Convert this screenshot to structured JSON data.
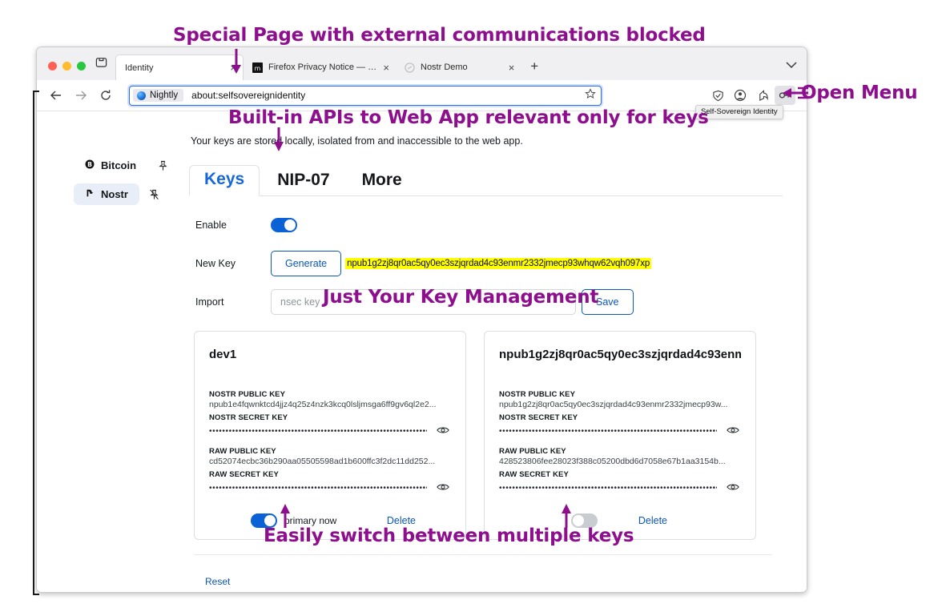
{
  "annotations": [
    {
      "id": "top",
      "text": "Special Page with external communications blocked"
    },
    {
      "id": "apis",
      "text": "Built-in APIs to Web App relevant only for keys"
    },
    {
      "id": "menu",
      "text": "Open Menu"
    },
    {
      "id": "keymgmt",
      "text": "Just Your Key Management"
    },
    {
      "id": "switch",
      "text": "Easily switch between multiple keys"
    }
  ],
  "annotation_color": "#8e0f8e",
  "browser": {
    "tabs": [
      {
        "label": "Identity",
        "favicon": "none",
        "active": true,
        "close": "×"
      },
      {
        "label": "Firefox Privacy Notice — Mozilla",
        "favicon": "mozilla-icon",
        "active": false,
        "close": "×"
      },
      {
        "label": "Nostr Demo",
        "favicon": "nostr-icon",
        "active": false,
        "close": "×"
      }
    ],
    "new_tab_label": "+",
    "window_controls": [
      "close",
      "minimize",
      "maximize"
    ],
    "nav": {
      "back": "←",
      "forward": "→",
      "reload": "⟳"
    },
    "urlbar": {
      "identity_chip": "Nightly",
      "url": "about:selfsovereignidentity",
      "bookmark_icon": "star-icon"
    },
    "toolbar_icons": [
      {
        "name": "shield-icon",
        "highlight": false
      },
      {
        "name": "account-icon",
        "highlight": false
      },
      {
        "name": "share-icon",
        "highlight": false
      },
      {
        "name": "key-icon",
        "highlight": true
      }
    ],
    "tooltip": "Self-Sovereign Identity"
  },
  "sidebar": {
    "items": [
      {
        "label": "Bitcoin",
        "icon": "bitcoin-icon",
        "pin": "pin-icon",
        "active": false
      },
      {
        "label": "Nostr",
        "icon": "nostr-icon",
        "pin": "unpin-icon",
        "active": true
      }
    ]
  },
  "main": {
    "subtitle": "Your keys are stored locally, isolated from and inaccessible to the web app.",
    "tabs": [
      {
        "label": "Keys",
        "active": true
      },
      {
        "label": "NIP-07",
        "active": false
      },
      {
        "label": "More",
        "active": false
      }
    ],
    "form": {
      "enable_label": "Enable",
      "enable_on": true,
      "newkey_label": "New Key",
      "generate_label": "Generate",
      "newkey_value": "npub1g2zj8qr0ac5qy0ec3szjqrdad4c93enmr2332jmecp93whqw62vqh097xp",
      "import_label": "Import",
      "import_placeholder": "nsec key",
      "import_value": "",
      "save_label": "Save"
    },
    "field_labels": {
      "nostr_public": "NOSTR PUBLIC KEY",
      "nostr_secret": "NOSTR SECRET KEY",
      "raw_public": "RAW PUBLIC KEY",
      "raw_secret": "RAW SECRET KEY"
    },
    "secret_mask": "••••••••••••••••••••••••••••••••••••••••••••••••••••••••••••••••••••",
    "cards": [
      {
        "title": "dev1",
        "nostr_public": "npub1e4fqwnktcd4jjz4q25z4nzk3kcq0lsljmsga6ff9gv6ql2e2...",
        "raw_public": "cd52074ecbc36b290aa05505598ad1b600ffc3f2dc11dd252...",
        "primary": true,
        "primary_label": "primary now",
        "delete_label": "Delete"
      },
      {
        "title": "npub1g2zj8qr0ac5qy0ec3szjqrdad4c93enm",
        "nostr_public": "npub1g2zj8qr0ac5qy0ec3szjqrdad4c93enmr2332jmecp93w...",
        "raw_public": "428523806fee28023f388c05200dbd6d7058e67b1aa3154b...",
        "primary": false,
        "primary_label": "",
        "delete_label": "Delete"
      }
    ],
    "reset_label": "Reset"
  }
}
